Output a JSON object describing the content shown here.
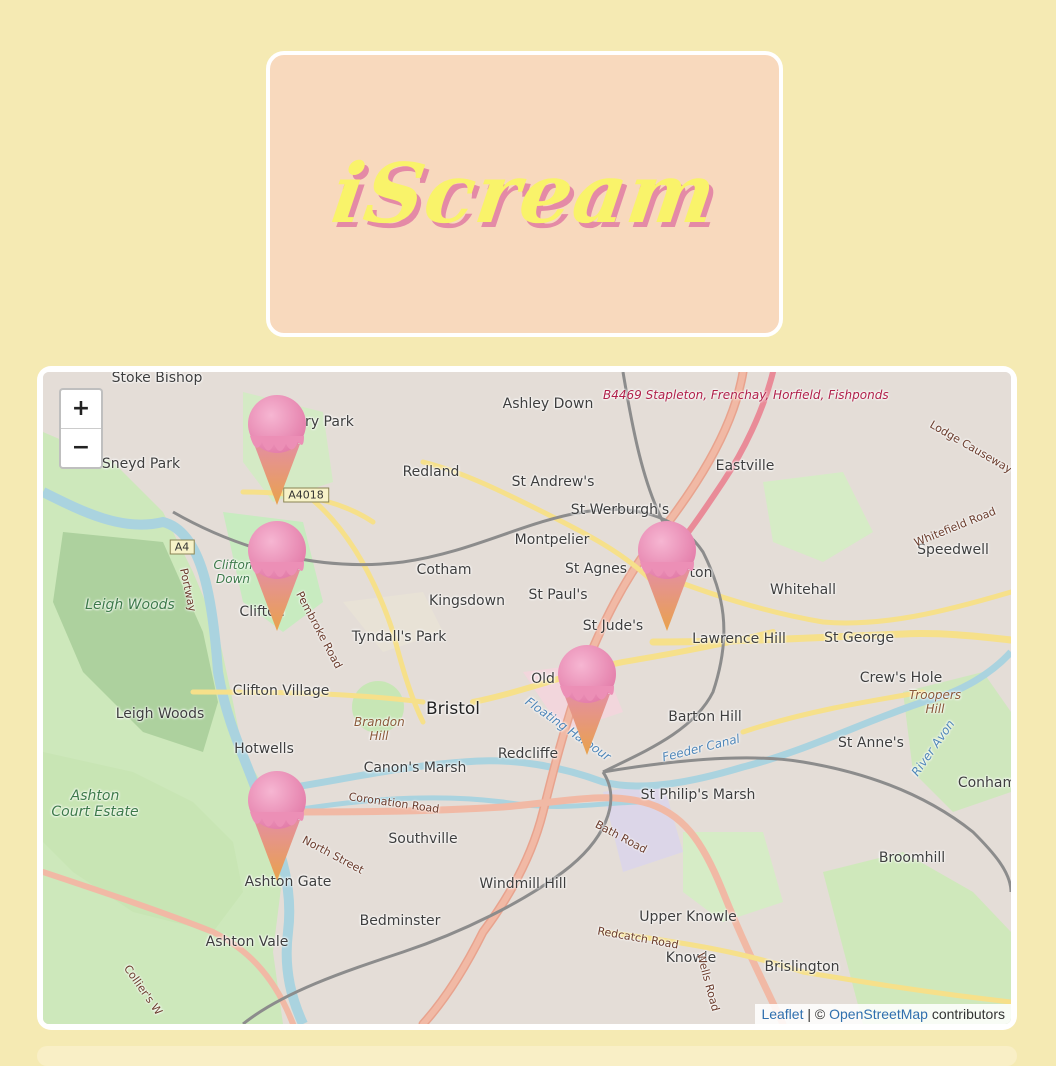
{
  "header": {
    "logo_text": "iScream"
  },
  "map": {
    "zoom_in": "+",
    "zoom_out": "−",
    "places": [
      "Stoke Bishop",
      "Ashley Down",
      "Redland",
      "St Andrew's",
      "Eastville",
      "St Werburgh's",
      "Sneyd Park",
      "Montpelier",
      "Speedwell",
      "Cotham",
      "St Agnes",
      "Whitehall",
      "Kingsdown",
      "St Paul's",
      "St Jude's",
      "Lawrence Hill",
      "St George",
      "Tyndall's Park",
      "Crew's Hole",
      "Clifton Village",
      "Bristol",
      "Barton Hill",
      "Leigh Woods",
      "Hotwells",
      "Redcliffe",
      "St Anne's",
      "Canon's Marsh",
      "St Philip's Marsh",
      "Conham",
      "Southville",
      "Broomhill",
      "Ashton Gate",
      "Windmill Hill",
      "Bedminster",
      "Upper Knowle",
      "Ashton Vale",
      "Knowle",
      "Brislington",
      "Old",
      "ury Park",
      "Clifton",
      "ton"
    ],
    "park_labels": [
      "Leigh Woods",
      "Ashton Court Estate",
      "Clifton Down",
      "Brandon Hill",
      "Troopers Hill"
    ],
    "road_labels": [
      "Pembroke Road",
      "Coronation Road",
      "North Street",
      "Bath Road",
      "Redcatch Road",
      "Wells Road",
      "Portway",
      "Lodge Causeway",
      "Whitefield Road",
      "Collier's W"
    ],
    "shields": [
      "A4018",
      "A4"
    ],
    "highlight_road": "B4469 Stapleton, Frenchay, Horfield, Fishponds",
    "water_labels": [
      "Floating Harbour",
      "Feeder Canal",
      "River Avon"
    ],
    "markers": [
      "ice-cream-marker-1",
      "ice-cream-marker-2",
      "ice-cream-marker-3",
      "ice-cream-marker-4",
      "ice-cream-marker-5"
    ],
    "attribution": {
      "leaflet": "Leaflet",
      "sep": " | © ",
      "osm": "OpenStreetMap",
      "suffix": " contributors"
    }
  },
  "colors": {
    "page_bg": "#f5eab3",
    "logo_bg": "#f8d9bd",
    "logo_text": "#f9f36a",
    "logo_shadow": "#e48aa6",
    "ice_cream_scoop": "#ec8fb6",
    "cone": "#e9a24c"
  }
}
